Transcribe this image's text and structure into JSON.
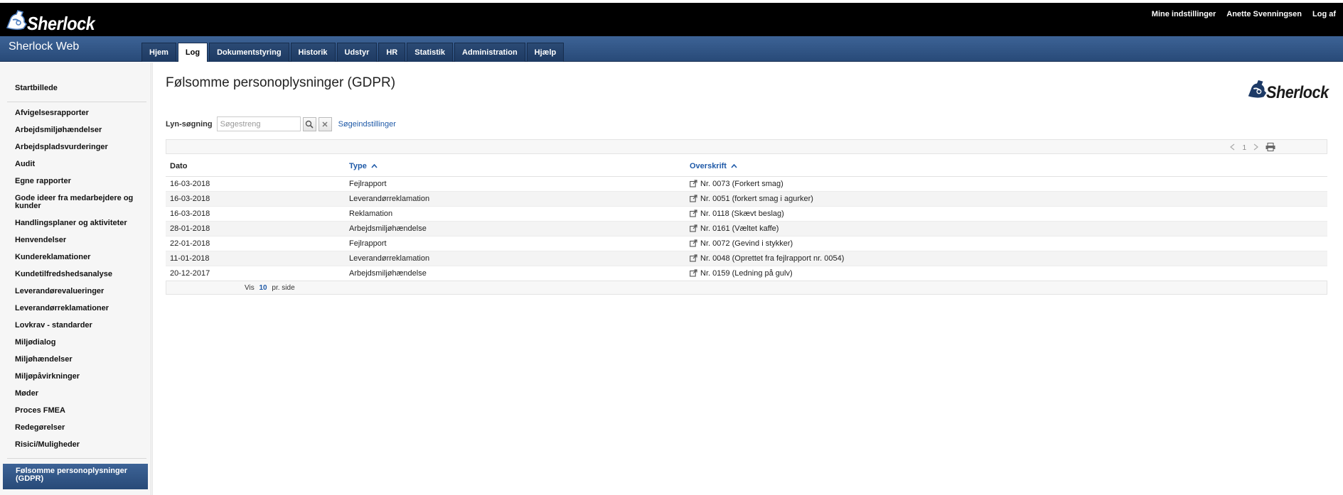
{
  "app": {
    "logo_text": "Sherlock",
    "brand_name": "Sherlock Web",
    "colors": {
      "nav_blue": "#2f5384",
      "link_blue": "#1f5aa8",
      "top_bar": "#000000"
    }
  },
  "user_menu": {
    "settings": "Mine indstillinger",
    "user_name": "Anette Svenningsen",
    "logout": "Log af"
  },
  "nav_tabs": [
    {
      "label": "Hjem"
    },
    {
      "label": "Log"
    },
    {
      "label": "Dokumentstyring"
    },
    {
      "label": "Historik"
    },
    {
      "label": "Udstyr"
    },
    {
      "label": "HR"
    },
    {
      "label": "Statistik"
    },
    {
      "label": "Administration"
    },
    {
      "label": "Hjælp"
    }
  ],
  "sidebar": {
    "home": "Startbillede",
    "items": [
      "Afvigelsesrapporter",
      "Arbejdsmiljøhændelser",
      "Arbejdspladsvurderinger",
      "Audit",
      "Egne rapporter",
      "Gode ideer fra medarbejdere og kunder",
      "Handlingsplaner og aktiviteter",
      "Henvendelser",
      "Kundereklamationer",
      "Kundetilfredshedsanalyse",
      "Leverandørevalueringer",
      "Leverandørreklamationer",
      "Lovkrav - standarder",
      "Miljødialog",
      "Miljøhændelser",
      "Miljøpåvirkninger",
      "Møder",
      "Proces FMEA",
      "Redegørelser",
      "Risici/Muligheder"
    ],
    "active": "Følsomme personoplysninger (GDPR)"
  },
  "page": {
    "title": "Følsomme personoplysninger (GDPR)",
    "search_label": "Lyn-søgning",
    "search_placeholder": "Søgestreng",
    "search_value": "",
    "search_settings": "Søgeindstillinger",
    "page_number": "1",
    "per_page_prefix": "Vis",
    "per_page_value": "10",
    "per_page_suffix": "pr. side",
    "icons": [
      "search-icon",
      "clear-icon",
      "prev-page-icon",
      "next-page-icon",
      "print-icon",
      "external-link-icon",
      "sort-asc-icon"
    ]
  },
  "table": {
    "columns": [
      "Dato",
      "Type",
      "Overskrift"
    ],
    "rows": [
      {
        "date": "16-03-2018",
        "type": "Fejlrapport",
        "title": "Nr. 0073 (Forkert smag)"
      },
      {
        "date": "16-03-2018",
        "type": "Leverandørreklamation",
        "title": "Nr. 0051 (forkert smag i agurker)"
      },
      {
        "date": "16-03-2018",
        "type": "Reklamation",
        "title": "Nr. 0118 (Skævt beslag)"
      },
      {
        "date": "28-01-2018",
        "type": "Arbejdsmiljøhændelse",
        "title": "Nr. 0161 (Væltet kaffe)"
      },
      {
        "date": "22-01-2018",
        "type": "Fejlrapport",
        "title": "Nr. 0072 (Gevind i stykker)"
      },
      {
        "date": "11-01-2018",
        "type": "Leverandørreklamation",
        "title": "Nr. 0048 (Oprettet fra fejlrapport nr. 0054)"
      },
      {
        "date": "20-12-2017",
        "type": "Arbejdsmiljøhændelse",
        "title": "Nr. 0159 (Ledning på gulv)"
      }
    ]
  }
}
